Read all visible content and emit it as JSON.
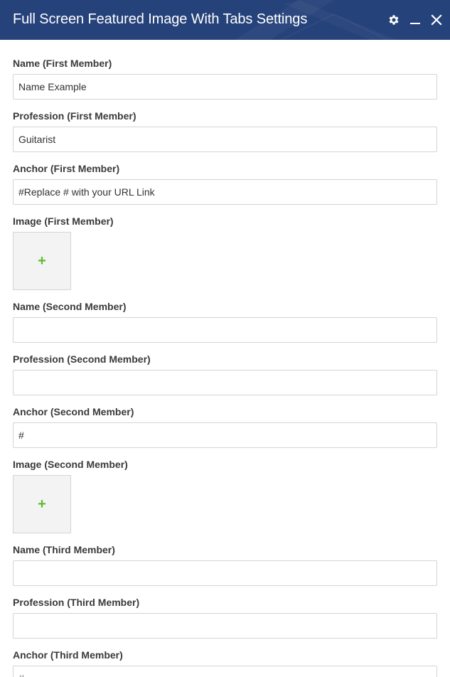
{
  "window": {
    "title": "Full Screen Featured Image With Tabs Settings",
    "header_color": "#26427a",
    "icons": [
      "gear-icon",
      "minimize-icon",
      "close-icon"
    ]
  },
  "fields": [
    {
      "label": "Name (First Member)",
      "type": "text",
      "value": "Name Example"
    },
    {
      "label": "Profession (First Member)",
      "type": "text",
      "value": "Guitarist"
    },
    {
      "label": "Anchor (First Member)",
      "type": "text",
      "value": "#Replace # with your URL Link"
    },
    {
      "label": "Image (First Member)",
      "type": "image",
      "button": "+"
    },
    {
      "label": "Name (Second Member)",
      "type": "text",
      "value": ""
    },
    {
      "label": "Profession (Second Member)",
      "type": "text",
      "value": ""
    },
    {
      "label": "Anchor (Second Member)",
      "type": "text",
      "value": "#"
    },
    {
      "label": "Image (Second Member)",
      "type": "image",
      "button": "+"
    },
    {
      "label": "Name (Third Member)",
      "type": "text",
      "value": ""
    },
    {
      "label": "Profession (Third Member)",
      "type": "text",
      "value": ""
    },
    {
      "label": "Anchor (Third Member)",
      "type": "text",
      "value": "#"
    }
  ],
  "colors": {
    "add_image_plus": "#5fb832",
    "label_text": "#3a3a3a"
  }
}
